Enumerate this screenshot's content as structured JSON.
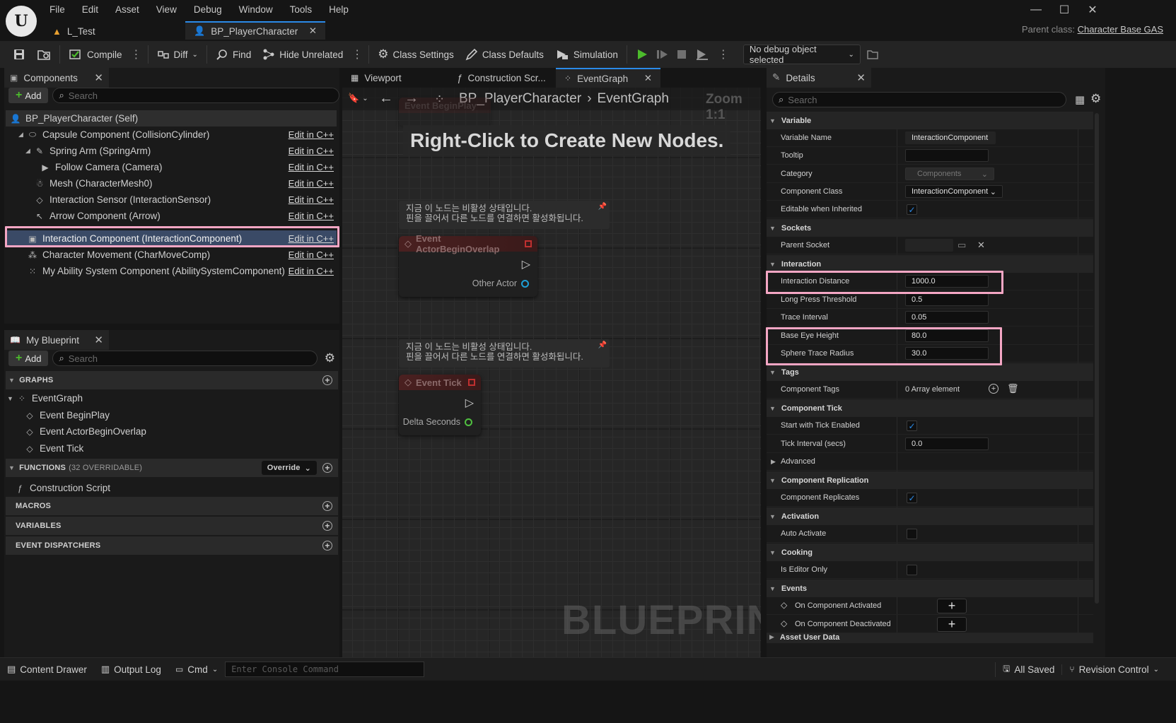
{
  "menu": [
    "File",
    "Edit",
    "Asset",
    "View",
    "Debug",
    "Window",
    "Tools",
    "Help"
  ],
  "tabs": {
    "level": "L_Test",
    "blueprint": "BP_PlayerCharacter"
  },
  "parent_class_label": "Parent class:",
  "parent_class_value": "Character Base GAS",
  "toolbar": {
    "compile": "Compile",
    "diff": "Diff",
    "find": "Find",
    "hide_unrelated": "Hide Unrelated",
    "class_settings": "Class Settings",
    "class_defaults": "Class Defaults",
    "simulation": "Simulation",
    "debug_object": "No debug object selected"
  },
  "components": {
    "title": "Components",
    "add": "Add",
    "search_placeholder": "Search",
    "edit_label": "Edit in C++",
    "items": [
      {
        "label": "BP_PlayerCharacter (Self)"
      },
      {
        "label": "Capsule Component (CollisionCylinder)"
      },
      {
        "label": "Spring Arm (SpringArm)"
      },
      {
        "label": "Follow Camera (Camera)"
      },
      {
        "label": "Mesh (CharacterMesh0)"
      },
      {
        "label": "Interaction Sensor (InteractionSensor)"
      },
      {
        "label": "Arrow Component (Arrow)"
      },
      {
        "label": "Interaction Component (InteractionComponent)"
      },
      {
        "label": "Character Movement (CharMoveComp)"
      },
      {
        "label": "My Ability System Component (AbilitySystemComponent)"
      }
    ]
  },
  "my_blueprint": {
    "title": "My Blueprint",
    "add": "Add",
    "search_placeholder": "Search",
    "graphs": "GRAPHS",
    "event_graph": "EventGraph",
    "events": [
      "Event BeginPlay",
      "Event ActorBeginOverlap",
      "Event Tick"
    ],
    "functions": "FUNCTIONS",
    "functions_count": "(32 OVERRIDABLE)",
    "override": "Override",
    "construction_script": "Construction Script",
    "macros": "MACROS",
    "variables": "VARIABLES",
    "event_dispatchers": "EVENT DISPATCHERS"
  },
  "graph": {
    "tabs": [
      "Viewport",
      "Construction Scr...",
      "EventGraph"
    ],
    "breadcrumb_root": "BP_PlayerCharacter",
    "breadcrumb_leaf": "EventGraph",
    "zoom": "Zoom 1:1",
    "hint": "Right-Click to Create New Nodes.",
    "comment_line1": "지금 이 노드는 비활성 상태입니다.",
    "comment_line2": "핀을 끌어서 다른 노드를 연결하면 활성화됩니다.",
    "node1_title": "Event ActorBeginOverlap",
    "node1_pin": "Other Actor",
    "node2_title": "Event Tick",
    "node2_pin": "Delta Seconds",
    "watermark": "BLUEPRINT",
    "ghost_title": "Event BeginPlay"
  },
  "details": {
    "title": "Details",
    "search_placeholder": "Search",
    "sections": {
      "variable": "Variable",
      "sockets": "Sockets",
      "interaction": "Interaction",
      "tags": "Tags",
      "component_tick": "Component Tick",
      "advanced": "Advanced",
      "component_replication": "Component Replication",
      "activation": "Activation",
      "cooking": "Cooking",
      "events": "Events",
      "asset_user_data": "Asset User Data"
    },
    "variable_name_label": "Variable Name",
    "variable_name": "InteractionComponent",
    "tooltip_label": "Tooltip",
    "tooltip": "",
    "category_label": "Category",
    "category": "Components",
    "component_class_label": "Component Class",
    "component_class": "InteractionComponent",
    "editable_inherited_label": "Editable when Inherited",
    "editable_inherited": true,
    "parent_socket_label": "Parent Socket",
    "interaction_distance_label": "Interaction Distance",
    "interaction_distance": "1000.0",
    "long_press_label": "Long Press Threshold",
    "long_press": "0.5",
    "trace_interval_label": "Trace Interval",
    "trace_interval": "0.05",
    "base_eye_height_label": "Base Eye Height",
    "base_eye_height": "80.0",
    "sphere_trace_radius_label": "Sphere Trace Radius",
    "sphere_trace_radius": "30.0",
    "component_tags_label": "Component Tags",
    "component_tags": "0 Array element",
    "start_tick_label": "Start with Tick Enabled",
    "start_tick": true,
    "tick_interval_label": "Tick Interval (secs)",
    "tick_interval": "0.0",
    "replicates_label": "Component Replicates",
    "replicates": true,
    "auto_activate_label": "Auto Activate",
    "auto_activate": false,
    "editor_only_label": "Is Editor Only",
    "editor_only": false,
    "on_activated_label": "On Component Activated",
    "on_deactivated_label": "On Component Deactivated"
  },
  "statusbar": {
    "content_drawer": "Content Drawer",
    "output_log": "Output Log",
    "cmd": "Cmd",
    "console_placeholder": "Enter Console Command",
    "all_saved": "All Saved",
    "revision_control": "Revision Control"
  },
  "colors": {
    "highlight": "#f4a6c4",
    "selected_row": "#3a4a66",
    "play_green": "#4cbb2c",
    "check_blue": "#2b8ae8"
  }
}
